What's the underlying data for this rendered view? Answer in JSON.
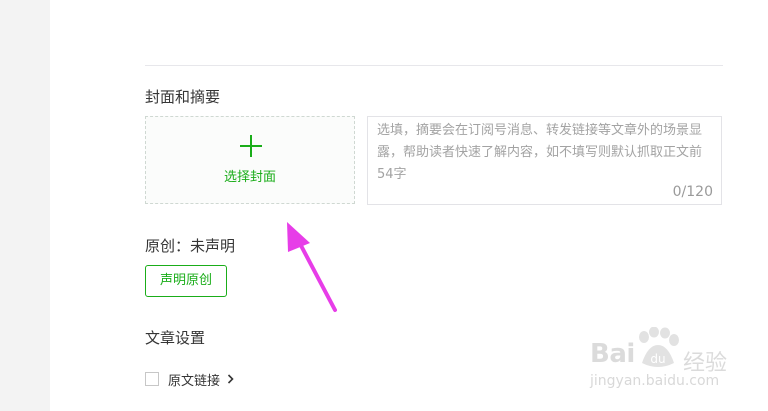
{
  "sections": {
    "cover_abstract_title": "封面和摘要",
    "original_status_title": "原创：未声明",
    "article_settings_title": "文章设置"
  },
  "cover": {
    "label": "选择封面",
    "icon": "plus-icon"
  },
  "abstract": {
    "placeholder": "选填，摘要会在订阅号消息、转发链接等文章外的场景显露，帮助读者快速了解内容，如不填写则默认抓取正文前54字",
    "value": "",
    "counter": "0/120"
  },
  "original": {
    "button_label": "声明原创"
  },
  "settings": {
    "original_link_label": "原文链接",
    "original_link_checked": false
  },
  "annotation": {
    "color": "#e73de8"
  },
  "watermark": {
    "brand": "Bai",
    "paw_text": "du",
    "product": "经验",
    "url": "jingyan.baidu.com"
  },
  "colors": {
    "accent": "#1aad19",
    "text": "#353535",
    "placeholder": "#a3a3a3",
    "border": "#e3e3e7"
  }
}
